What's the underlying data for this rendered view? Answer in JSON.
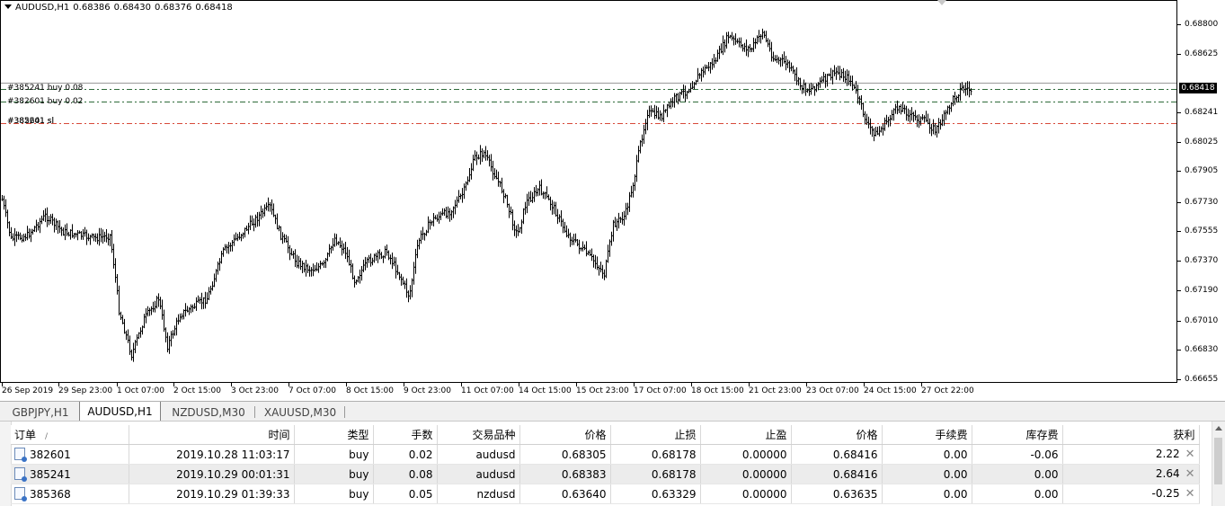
{
  "chart": {
    "header": {
      "symbol": "AUDUSD,H1",
      "open": "0.68386",
      "high": "0.68430",
      "low": "0.68376",
      "close": "0.68418"
    },
    "order_lines": [
      {
        "label": "#385241 buy 0.08",
        "price": 0.68383,
        "style": "dashdot",
        "color": "#2f6b3a"
      },
      {
        "label": "#382601 buy 0.02",
        "price": 0.68305,
        "style": "dashdot",
        "color": "#2f6b3a"
      },
      {
        "label": "#385241 sl",
        "price": 0.68178,
        "style": "dashdot",
        "color": "#d84a3a"
      }
    ],
    "overlapped_label": "#382601 sl",
    "bid_line_price": 0.68418,
    "current_price": "0.68418",
    "price_ticks": [
      "0.68800",
      "0.68625",
      "0.68241",
      "0.68025",
      "0.67905",
      "0.67730",
      "0.67555",
      "0.67370",
      "0.67190",
      "0.67010",
      "0.66830",
      "0.66655"
    ],
    "time_ticks": [
      "26 Sep 2019",
      "29 Sep 23:00",
      "1 Oct 07:00",
      "2 Oct 15:00",
      "3 Oct 23:00",
      "7 Oct 07:00",
      "8 Oct 15:00",
      "9 Oct 23:00",
      "11 Oct 07:00",
      "14 Oct 15:00",
      "15 Oct 23:00",
      "17 Oct 07:00",
      "18 Oct 15:00",
      "21 Oct 23:00",
      "23 Oct 07:00",
      "24 Oct 15:00",
      "27 Oct 22:00"
    ],
    "colors": {
      "candle": "#000000",
      "background": "#ffffff",
      "order_line": "#2f6b3a",
      "sl_line": "#d84a3a"
    }
  },
  "tabs": [
    {
      "label": "GBPJPY,H1",
      "active": false
    },
    {
      "label": "AUDUSD,H1",
      "active": true
    },
    {
      "label": "NZDUSD,M30",
      "active": false
    },
    {
      "label": "XAUUSD,M30",
      "active": false
    }
  ],
  "terminal": {
    "columns": [
      "订单",
      "时间",
      "类型",
      "手数",
      "交易品种",
      "价格",
      "止损",
      "止盈",
      "价格",
      "手续费",
      "库存费",
      "获利"
    ],
    "sort_indicator": "/",
    "rows": [
      {
        "ticket": "382601",
        "time": "2019.10.28 11:03:17",
        "type": "buy",
        "lots": "0.02",
        "symbol": "audusd",
        "price": "0.68305",
        "sl": "0.68178",
        "tp": "0.00000",
        "cur": "0.68416",
        "commission": "0.00",
        "swap": "-0.06",
        "profit": "2.22"
      },
      {
        "ticket": "385241",
        "time": "2019.10.29 00:01:31",
        "type": "buy",
        "lots": "0.08",
        "symbol": "audusd",
        "price": "0.68383",
        "sl": "0.68178",
        "tp": "0.00000",
        "cur": "0.68416",
        "commission": "0.00",
        "swap": "0.00",
        "profit": "2.64"
      },
      {
        "ticket": "385368",
        "time": "2019.10.29 01:39:33",
        "type": "buy",
        "lots": "0.05",
        "symbol": "nzdusd",
        "price": "0.63640",
        "sl": "0.63329",
        "tp": "0.00000",
        "cur": "0.63635",
        "commission": "0.00",
        "swap": "0.00",
        "profit": "-0.25"
      }
    ],
    "close_glyph": "✕"
  }
}
